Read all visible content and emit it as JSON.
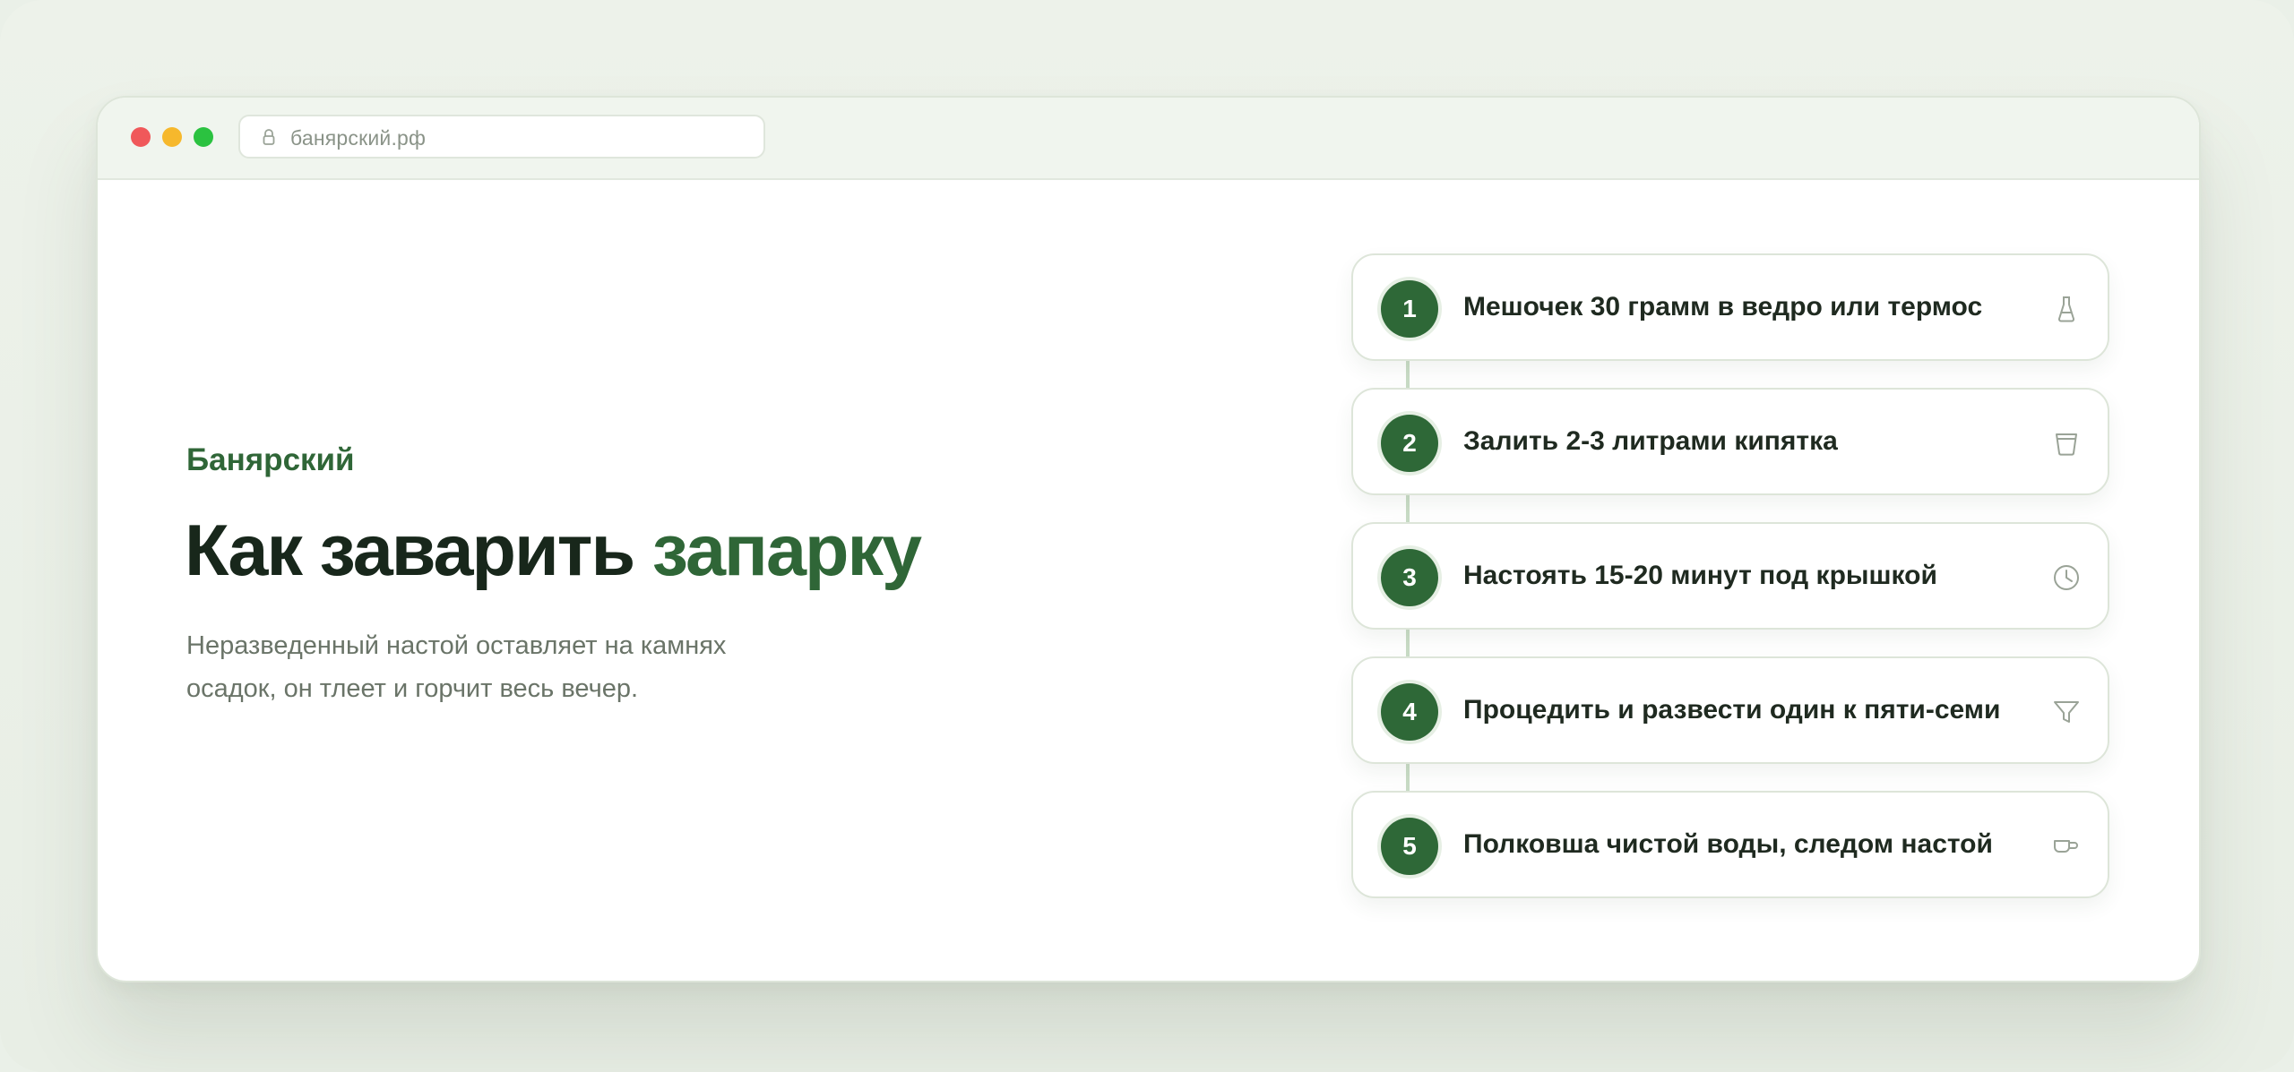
{
  "browser": {
    "url": "банярский.рф"
  },
  "hero": {
    "brand": "Банярский",
    "title_main": "Как заварить",
    "title_accent": "запарку",
    "lead": "Неразведенный настой оставляет на камнях осадок, он тлеет и горчит весь вечер."
  },
  "steps": [
    {
      "number": "1",
      "label": "Мешочек 30 грамм в ведро или термос",
      "icon": "flask-icon"
    },
    {
      "number": "2",
      "label": "Залить 2-3 литрами кипятка",
      "icon": "bucket-icon"
    },
    {
      "number": "3",
      "label": "Настоять 15-20 минут под крышкой",
      "icon": "clock-icon"
    },
    {
      "number": "4",
      "label": "Процедить и развести один к пяти-семи",
      "icon": "filter-icon"
    },
    {
      "number": "5",
      "label": "Полковша чистой воды, следом настой",
      "icon": "ladle-icon"
    }
  ],
  "colors": {
    "accent": "#2f6637",
    "text_dark": "#18271b",
    "muted": "#6a7468"
  }
}
